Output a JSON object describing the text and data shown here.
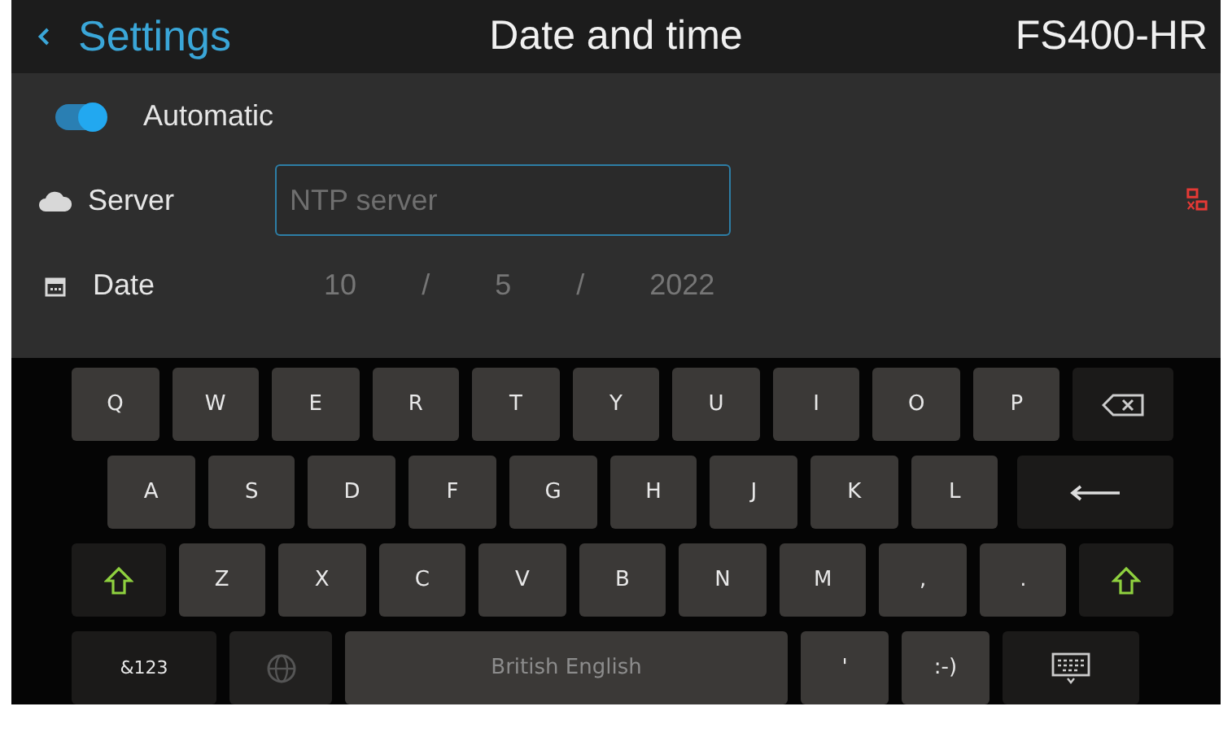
{
  "header": {
    "back_label": "Settings",
    "title": "Date and time",
    "device": "FS400-HR"
  },
  "automatic": {
    "label": "Automatic",
    "on": true
  },
  "server": {
    "label": "Server",
    "placeholder": "NTP server",
    "connected": false
  },
  "date": {
    "label": "Date",
    "day": "10",
    "month": "5",
    "year": "2022",
    "separator": "/"
  },
  "keyboard": {
    "rows": [
      {
        "keys": [
          {
            "kind": "char",
            "label": "Q"
          },
          {
            "kind": "char",
            "label": "W"
          },
          {
            "kind": "char",
            "label": "E"
          },
          {
            "kind": "char",
            "label": "R"
          },
          {
            "kind": "char",
            "label": "T"
          },
          {
            "kind": "char",
            "label": "Y"
          },
          {
            "kind": "char",
            "label": "U"
          },
          {
            "kind": "char",
            "label": "I"
          },
          {
            "kind": "char",
            "label": "O"
          },
          {
            "kind": "char",
            "label": "P"
          },
          {
            "kind": "backspace"
          }
        ]
      },
      {
        "keys": [
          {
            "kind": "char",
            "label": "A"
          },
          {
            "kind": "char",
            "label": "S"
          },
          {
            "kind": "char",
            "label": "D"
          },
          {
            "kind": "char",
            "label": "F"
          },
          {
            "kind": "char",
            "label": "G"
          },
          {
            "kind": "char",
            "label": "H"
          },
          {
            "kind": "char",
            "label": "J"
          },
          {
            "kind": "char",
            "label": "K"
          },
          {
            "kind": "char",
            "label": "L"
          },
          {
            "kind": "enter"
          }
        ]
      },
      {
        "keys": [
          {
            "kind": "shift"
          },
          {
            "kind": "char",
            "label": "Z"
          },
          {
            "kind": "char",
            "label": "X"
          },
          {
            "kind": "char",
            "label": "C"
          },
          {
            "kind": "char",
            "label": "V"
          },
          {
            "kind": "char",
            "label": "B"
          },
          {
            "kind": "char",
            "label": "N"
          },
          {
            "kind": "char",
            "label": "M"
          },
          {
            "kind": "char",
            "label": ","
          },
          {
            "kind": "char",
            "label": "."
          },
          {
            "kind": "shift"
          }
        ]
      },
      {
        "keys": [
          {
            "kind": "mode",
            "label": "&123"
          },
          {
            "kind": "language",
            "disabled": true
          },
          {
            "kind": "space",
            "label": "British English"
          },
          {
            "kind": "char",
            "label": "'"
          },
          {
            "kind": "char",
            "label": ":-)"
          },
          {
            "kind": "hide"
          }
        ]
      }
    ]
  }
}
